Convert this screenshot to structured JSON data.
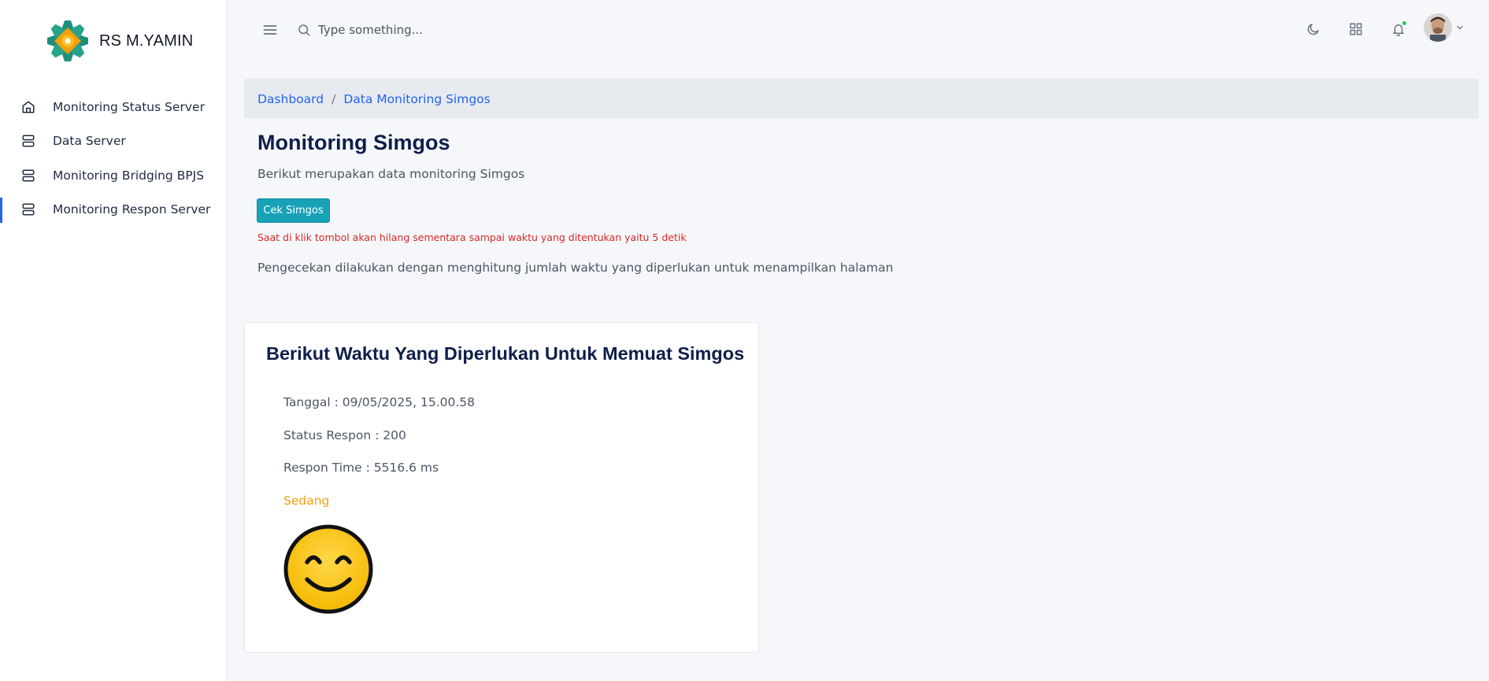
{
  "brand": {
    "name": "RS M.YAMIN"
  },
  "sidebar": {
    "items": [
      {
        "label": "Monitoring Status Server",
        "icon": "home-icon"
      },
      {
        "label": "Data Server",
        "icon": "server-icon"
      },
      {
        "label": "Monitoring Bridging BPJS",
        "icon": "server-icon"
      },
      {
        "label": "Monitoring Respon Server",
        "icon": "server-icon",
        "active": true
      }
    ]
  },
  "topbar": {
    "search_placeholder": "Type something..."
  },
  "breadcrumb": {
    "home": "Dashboard",
    "separator": "/",
    "current": "Data Monitoring Simgos"
  },
  "page": {
    "title": "Monitoring Simgos",
    "subtitle": "Berikut merupakan data monitoring Simgos",
    "button_label": "Cek Simgos",
    "warning": "Saat di klik tombol akan hilang sementara sampai waktu yang ditentukan yaitu 5 detik",
    "note": "Pengecekan dilakukan dengan menghitung jumlah waktu yang diperlukan untuk menampilkan halaman"
  },
  "card": {
    "title": "Berikut Waktu Yang Diperlukan Untuk Memuat Simgos",
    "tanggal": "Tanggal : 09/05/2025, 15.00.58",
    "status_respon": "Status Respon : 200",
    "respon_time": "Respon Time : 5516.6 ms",
    "status_label": "Sedang",
    "status_color": "#f59e0b"
  },
  "colors": {
    "accent": "#2563eb",
    "button": "#17a2b8",
    "warning": "#dc2626",
    "notification_dot": "#22c55e"
  }
}
